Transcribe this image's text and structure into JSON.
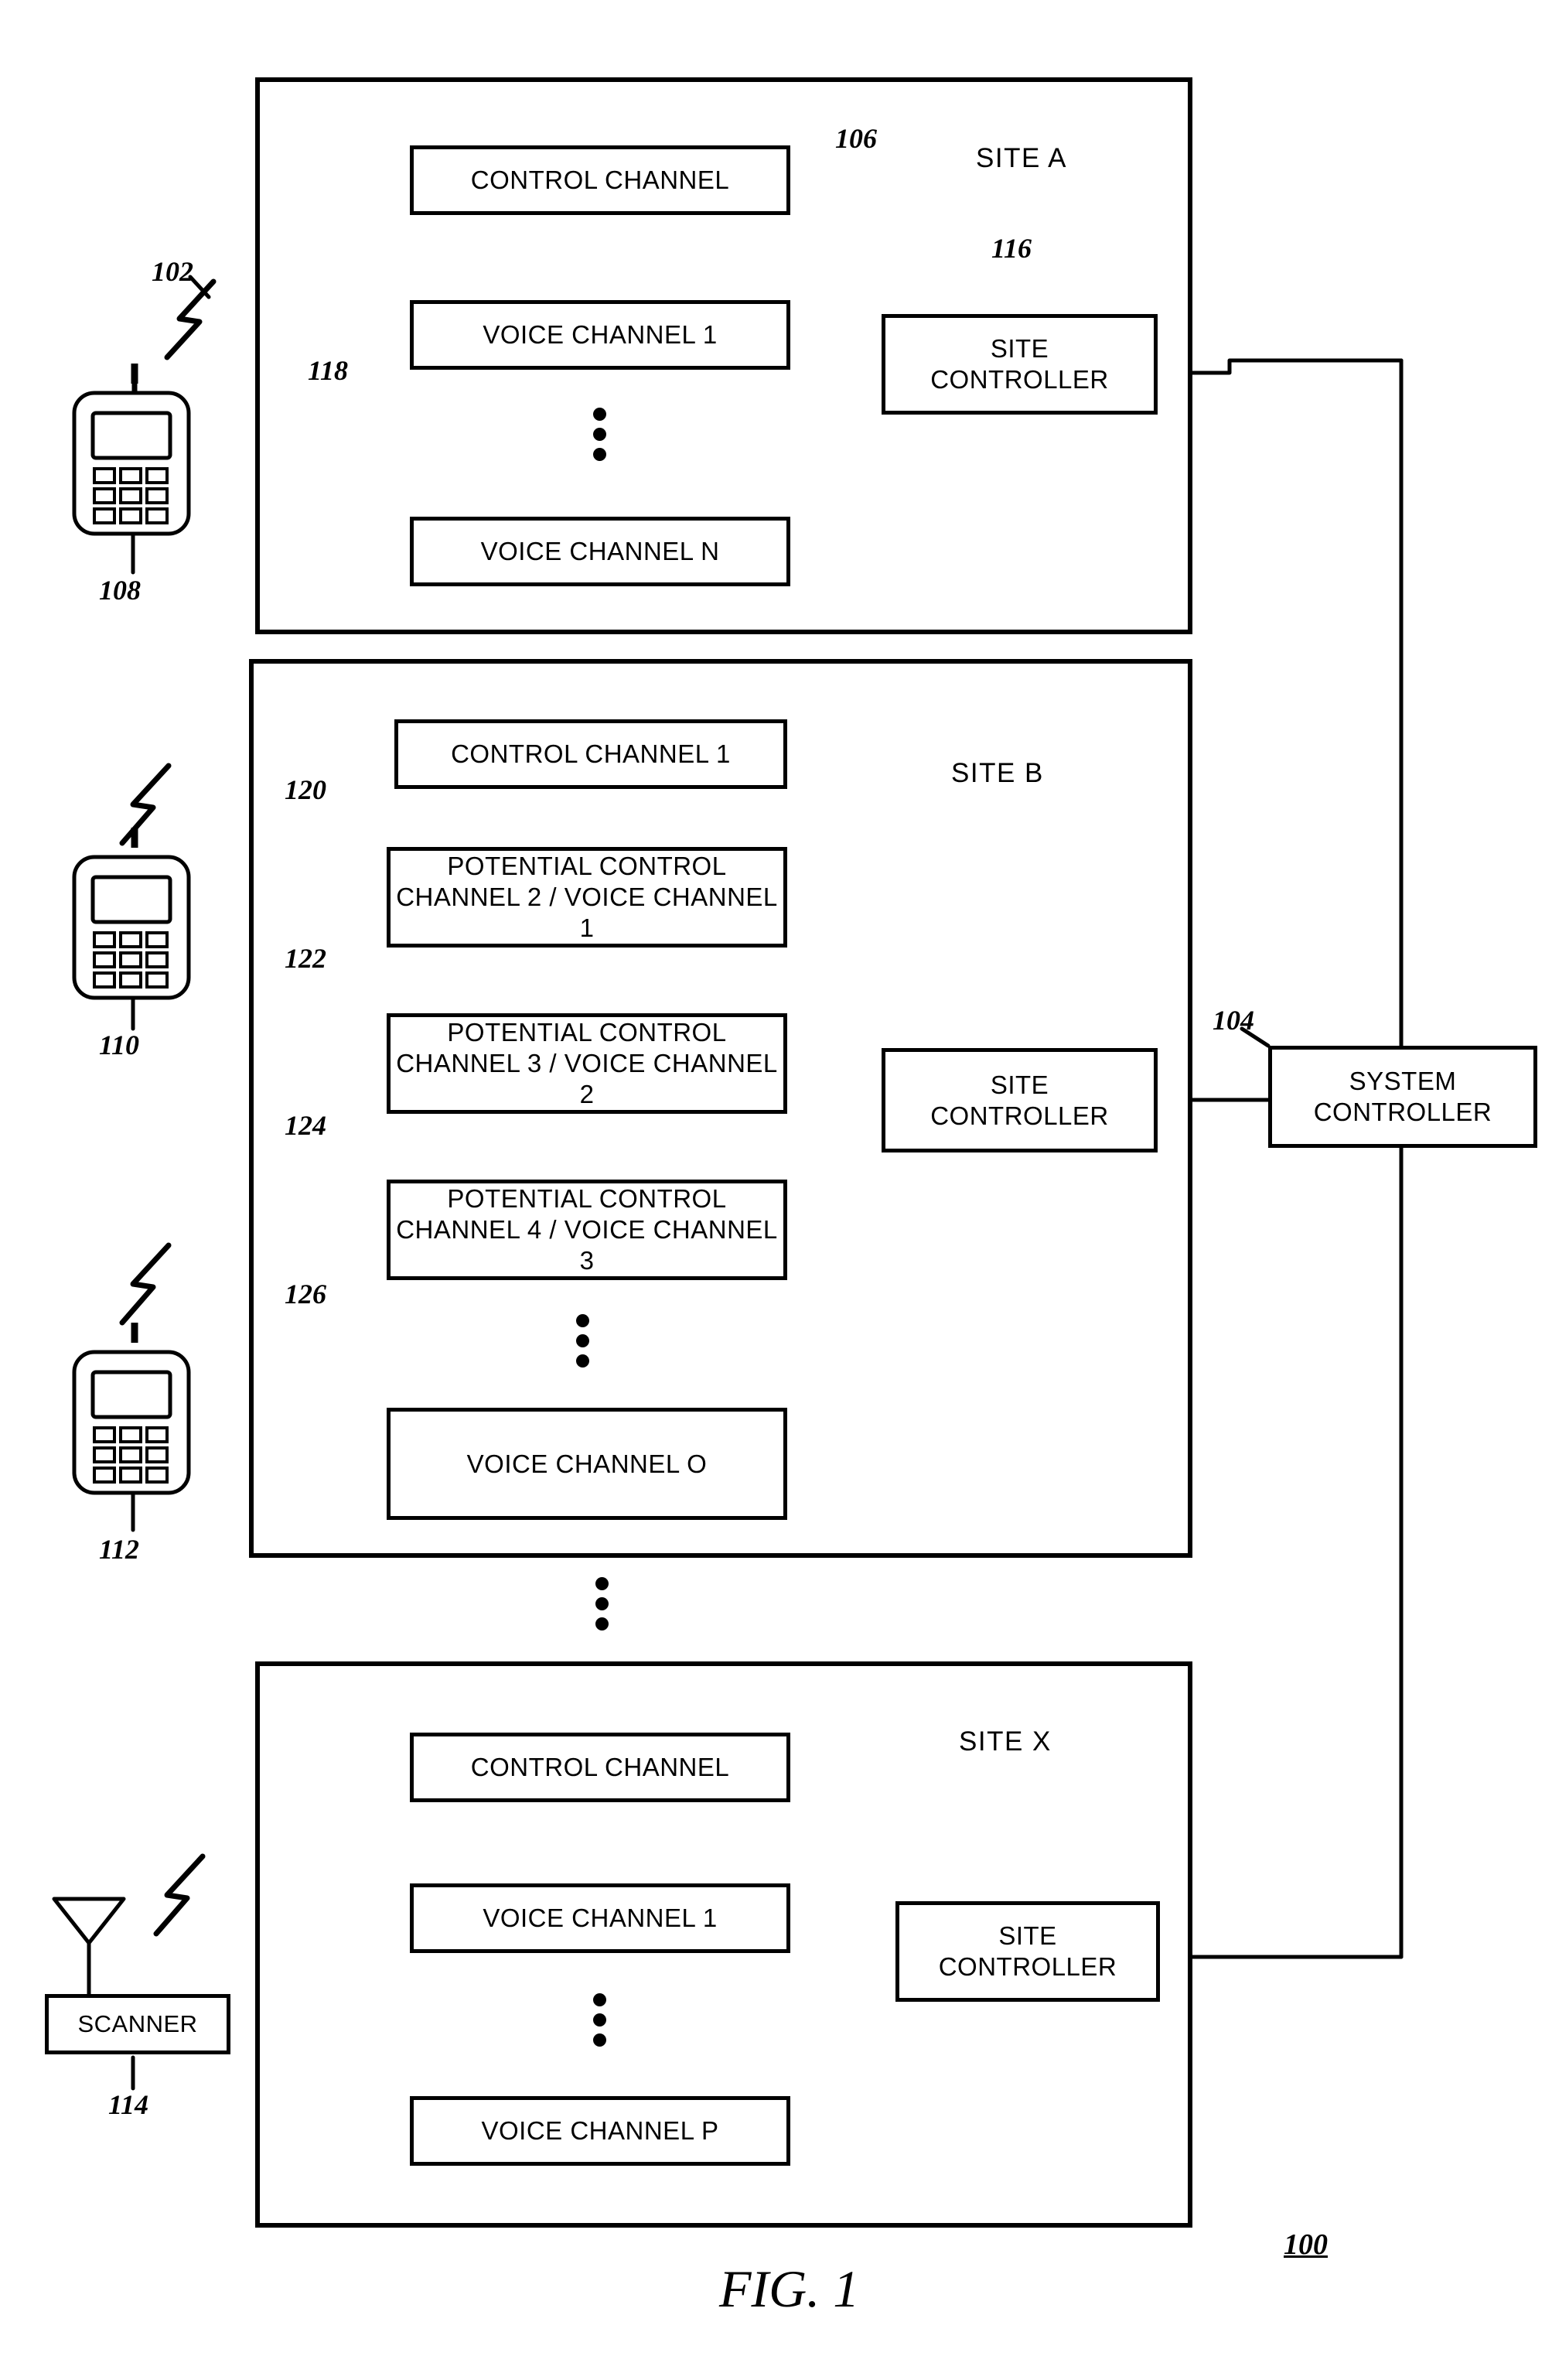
{
  "figure": {
    "caption": "FIG. 1",
    "system_ref": "100"
  },
  "refs": {
    "r102": "102",
    "r104": "104",
    "r106": "106",
    "r108": "108",
    "r110": "110",
    "r112": "112",
    "r114": "114",
    "r116": "116",
    "r118": "118",
    "r120": "120",
    "r122": "122",
    "r124": "124",
    "r126": "126"
  },
  "sites": {
    "a": {
      "name": "SITE A",
      "channels": [
        "CONTROL CHANNEL",
        "VOICE CHANNEL 1",
        "VOICE CHANNEL N"
      ],
      "controller": "SITE\nCONTROLLER",
      "controller_line1": "SITE",
      "controller_line2": "CONTROLLER"
    },
    "b": {
      "name": "SITE B",
      "channels": [
        "CONTROL CHANNEL 1",
        "POTENTIAL CONTROL CHANNEL 2 / VOICE CHANNEL 1",
        "POTENTIAL CONTROL CHANNEL 3 / VOICE CHANNEL 2",
        "POTENTIAL CONTROL CHANNEL 4 / VOICE CHANNEL 3",
        "VOICE CHANNEL O"
      ],
      "controller_line1": "SITE",
      "controller_line2": "CONTROLLER"
    },
    "x": {
      "name": "SITE  X",
      "channels": [
        "CONTROL CHANNEL",
        "VOICE CHANNEL 1",
        "VOICE CHANNEL P"
      ],
      "controller_line1": "SITE",
      "controller_line2": "CONTROLLER"
    }
  },
  "system_controller": {
    "line1": "SYSTEM",
    "line2": "CONTROLLER"
  },
  "scanner": {
    "label": "SCANNER"
  },
  "devices": {
    "mobile1": "mobile-phone-icon",
    "mobile2": "mobile-phone-icon",
    "mobile3": "mobile-phone-icon",
    "antenna": "antenna-icon",
    "lightning": "rf-link-icon"
  }
}
